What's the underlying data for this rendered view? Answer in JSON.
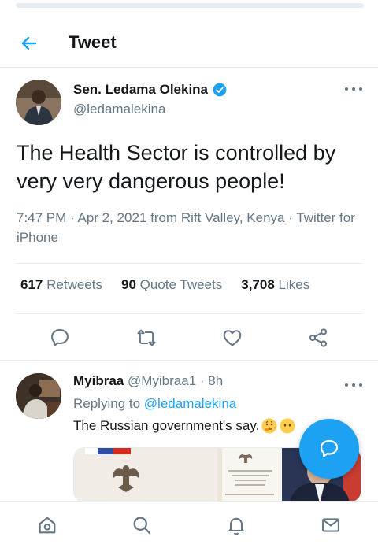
{
  "header": {
    "title": "Tweet"
  },
  "tweet": {
    "author_name": "Sen. Ledama Olekina",
    "author_handle": "@ledamalekina",
    "text": "The Health Sector is controlled by very very dangerous people!",
    "meta": "7:47 PM · Apr 2, 2021 from Rift Valley, Kenya · Twitter for iPhone",
    "stats": {
      "retweets_count": "617",
      "retweets_label": "Retweets",
      "quotes_count": "90",
      "quotes_label": "Quote Tweets",
      "likes_count": "3,708",
      "likes_label": "Likes"
    }
  },
  "reply": {
    "author_name": "Myibraa",
    "author_handle": "@Myibraa1",
    "time": "· 8h",
    "replying_prefix": "Replying to",
    "replying_to": "@ledamalekina",
    "text": "The Russian government's say."
  },
  "colors": {
    "accent": "#1da1f2",
    "text_primary": "#14171a",
    "text_secondary": "#657786",
    "divider": "#e6ecf0"
  },
  "icons": {
    "back": "arrow-left-icon",
    "verified": "verified-badge-icon",
    "more": "more-horizontal-icon",
    "reply": "comment-icon",
    "retweet": "retweet-icon",
    "like": "heart-icon",
    "share": "share-icon",
    "compose": "compose-icon",
    "nav_home": "home-icon",
    "nav_search": "search-icon",
    "nav_notifications": "bell-icon",
    "nav_messages": "mail-icon"
  }
}
